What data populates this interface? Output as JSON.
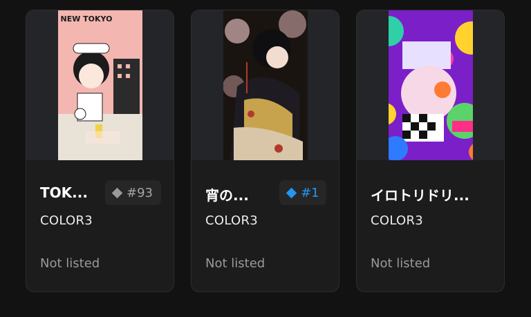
{
  "cards": [
    {
      "title": "TOK...",
      "art_text": "NEW TOKYO",
      "rank": "#93",
      "rank_color": "#9a9a9a",
      "collection": "COLOR3",
      "status": "Not listed"
    },
    {
      "title": "宵の...",
      "rank": "#1",
      "rank_color": "#2196f3",
      "collection": "COLOR3",
      "status": "Not listed"
    },
    {
      "title": "イロトリドリ...",
      "collection": "COLOR3",
      "status": "Not listed"
    }
  ]
}
